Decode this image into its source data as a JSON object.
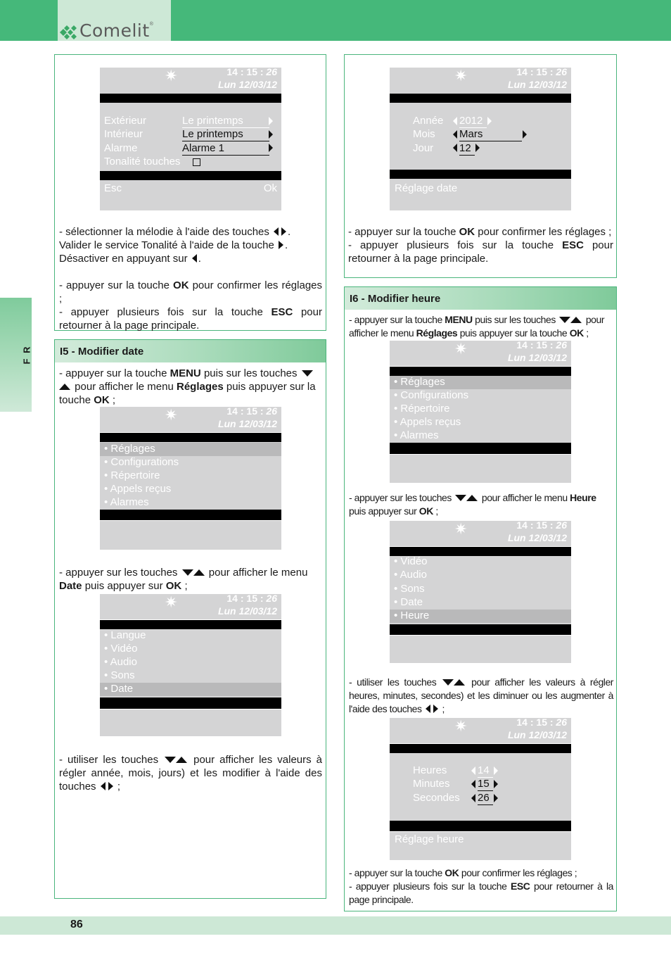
{
  "header": {
    "brand": "Comelit",
    "registered": "®"
  },
  "side_tab": {
    "label": "F R"
  },
  "footer": {
    "page_number": "86"
  },
  "colors": {
    "brand_green": "#45b87a",
    "light_green": "#cde8d6",
    "screen_gray": "#d4d4d5",
    "selected_gray": "#b9b9ba"
  },
  "screen_common": {
    "star_icon": "✷",
    "time_hm": "14 : 15 : ",
    "time_s": "26",
    "date": "Lun 12/03/12"
  },
  "box_a": {
    "screen": {
      "rows": [
        {
          "label": "Extérieur",
          "value": "Le printemps",
          "value_style": "white"
        },
        {
          "label": "Intérieur",
          "value": "Le printemps",
          "value_style": "dark"
        },
        {
          "label": "Alarme",
          "value": "Alarme 1",
          "value_style": "dark"
        }
      ],
      "toggle_label": "Tonalité touches",
      "toggle_checked": false,
      "esc_label": "Esc",
      "ok_label": "Ok"
    },
    "text": {
      "p1_a": "- sélectionner la mélodie à l'aide des touches",
      "p1_b": ".",
      "p2_a": "Valider le service Tonalité à l'aide de la touche",
      "p2_b": ".",
      "p3_a": "Désactiver en appuyant sur",
      "p3_b": ".",
      "p4_a": "- appuyer sur la touche",
      "p4_bold": "OK",
      "p4_b": "pour confirmer les réglages ;",
      "p5_a": "- appuyer plusieurs fois sur la touche",
      "p5_bold": "ESC",
      "p5_b": "pour retourner à la page principale."
    }
  },
  "box_b": {
    "screen": {
      "rows": [
        {
          "label": "Année",
          "value": "2012"
        },
        {
          "label": "Mois",
          "value": "Mars"
        },
        {
          "label": "Jour",
          "value": "12"
        }
      ],
      "footer_label": "Réglage date"
    },
    "text": {
      "p1_a": "- appuyer sur la touche",
      "p1_bold": "OK",
      "p1_b": "pour confirmer les réglages ;",
      "p2_a": "- appuyer plusieurs fois sur la touche",
      "p2_bold": "ESC",
      "p2_b": "pour retourner à la page principale."
    }
  },
  "box_c": {
    "title": "I5 - Modifier date",
    "step1": {
      "a": "- appuyer sur la touche",
      "bold1": "MENU",
      "b": "puis sur les touches",
      "c": "pour afficher le menu",
      "bold2": "Réglages",
      "d": "puis appuyer sur la touche",
      "bold3": "OK",
      "e": ";"
    },
    "menu1": {
      "items": [
        "• Réglages",
        "• Configurations",
        "• Répertoire",
        "• Appels reçus",
        "• Alarmes"
      ],
      "selected_index": 0
    },
    "step2": {
      "a": "- appuyer sur les touches",
      "b": "pour afficher le menu",
      "bold1": "Date",
      "c": "puis appuyer sur",
      "bold2": "OK",
      "d": ";"
    },
    "menu2": {
      "items": [
        "• Langue",
        "• Vidéo",
        "• Audio",
        "• Sons",
        "• Date"
      ],
      "selected_index": 4
    },
    "step3": {
      "a": "- utiliser les touches",
      "b": "pour afficher les valeurs à régler année, mois, jours) et les modifier à l'aide des touches",
      "c": ";"
    }
  },
  "box_d": {
    "title": "I6 - Modifier heure",
    "step1": {
      "a": "- appuyer sur la touche",
      "bold1": "MENU",
      "b": "puis sur les touches",
      "c": "pour afficher le menu",
      "bold2": "Réglages",
      "d": "puis appuyer sur la touche",
      "bold3": "OK",
      "e": ";"
    },
    "menu1": {
      "items": [
        "• Réglages",
        "• Configurations",
        "• Répertoire",
        "• Appels reçus",
        "• Alarmes"
      ],
      "selected_index": 0
    },
    "step2": {
      "a": "- appuyer sur les touches",
      "b": "pour afficher le menu",
      "bold1": "Heure",
      "c": "puis appuyer sur",
      "bold2": "OK",
      "d": ";"
    },
    "menu2": {
      "items": [
        "• Vidéo",
        "• Audio",
        "• Sons",
        "• Date",
        "• Heure"
      ],
      "selected_index": 4
    },
    "step3": {
      "a": "- utiliser les touches",
      "b": "pour afficher les valeurs à régler heures, minutes, secondes) et les diminuer ou les augmenter à l'aide des touches",
      "c": ";"
    },
    "screen": {
      "rows": [
        {
          "label": "Heures",
          "value": "14"
        },
        {
          "label": "Minutes",
          "value": "15"
        },
        {
          "label": "Secondes",
          "value": "26"
        }
      ],
      "footer_label": "Réglage heure"
    },
    "text": {
      "p1_a": "- appuyer sur la touche",
      "p1_bold": "OK",
      "p1_b": "pour confirmer les réglages ;",
      "p2_a": "- appuyer plusieurs fois sur la touche",
      "p2_bold": "ESC",
      "p2_b": "pour retourner à la page principale."
    }
  }
}
